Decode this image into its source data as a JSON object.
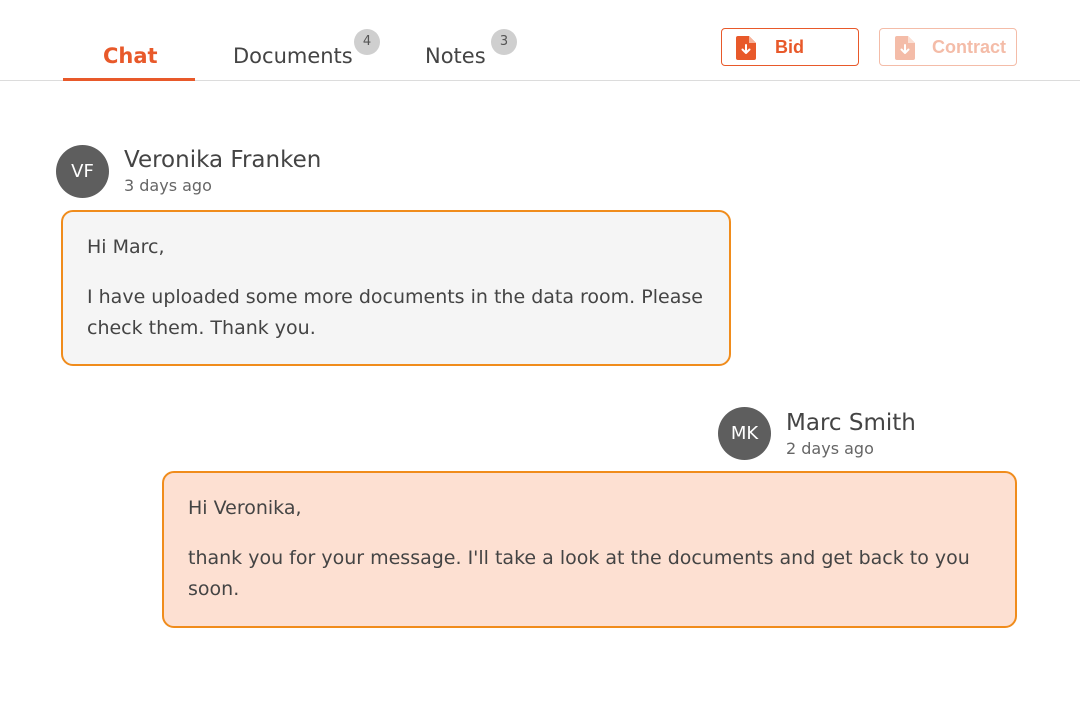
{
  "tabs": [
    {
      "label": "Chat",
      "active": true
    },
    {
      "label": "Documents",
      "badge": "4"
    },
    {
      "label": "Notes",
      "badge": "3"
    }
  ],
  "actions": {
    "bid": {
      "label": "Bid",
      "icon": "document-download-icon"
    },
    "contract": {
      "label": "Contract",
      "icon": "document-download-icon",
      "disabled": true
    }
  },
  "messages": [
    {
      "initials": "VF",
      "author": "Veronika Franken",
      "time": "3 days ago",
      "lines": [
        "Hi Marc,",
        "I have uploaded some more documents in the data room. Please check them. Thank you."
      ]
    },
    {
      "initials": "MK",
      "author": "Marc Smith",
      "time": "2 days ago",
      "lines": [
        "Hi Veronika,",
        "thank you for your message. I'll take a look at the documents and get back to you soon."
      ]
    }
  ],
  "colors": {
    "accent": "#e8592a",
    "bubble_border": "#f08c1c",
    "incoming_bg": "#f5f5f5",
    "outgoing_bg": "#fde0d2",
    "avatar_bg": "#5e5e5e"
  }
}
